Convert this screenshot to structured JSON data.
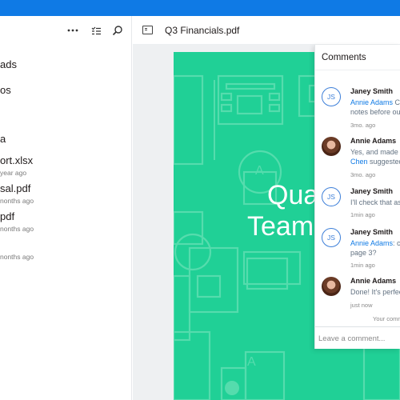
{
  "file_list": {
    "toolbar": {
      "more_icon": "more-horizontal-icon",
      "select_icon": "checklist-icon",
      "search_icon": "search-icon"
    },
    "items": [
      {
        "name": "ads",
        "sub": ""
      },
      {
        "name": "os",
        "sub": ""
      },
      {
        "name": "a",
        "sub": ""
      },
      {
        "name": "ort.xlsx",
        "sub": "year ago"
      },
      {
        "name": "sal.pdf",
        "sub": "nonths ago"
      },
      {
        "name": "pdf",
        "sub": "nonths ago"
      },
      {
        "name": "",
        "sub": "nonths ago"
      }
    ]
  },
  "viewer": {
    "file_title": "Q3 Financials.pdf",
    "doc_title_line1": "Qua",
    "doc_title_line2": "Team",
    "page_color": "#20d096"
  },
  "comments": {
    "title": "Comments",
    "items": [
      {
        "initials": "JS",
        "author": "Janey Smith",
        "mention": "Annie Adams",
        "text_l1": " Ca",
        "text_l2": "notes before our",
        "time": "3mo. ago",
        "avatar": "initials"
      },
      {
        "initials": "",
        "author": "Annie Adams",
        "mention": "",
        "text_l1": "Yes, and made su",
        "mention2": "Chen",
        "text_l2": " suggested",
        "time": "3mo. ago",
        "avatar": "photo"
      },
      {
        "initials": "JS",
        "author": "Janey Smith",
        "mention": "",
        "text_l1": "I'll check that as",
        "text_l2": "",
        "time": "1min ago",
        "avatar": "initials"
      },
      {
        "initials": "JS",
        "author": "Janey Smith",
        "mention": "Annie Adams",
        "text_l1": ": ca",
        "text_l2": "page 3?",
        "time": "1min ago",
        "avatar": "initials"
      },
      {
        "initials": "",
        "author": "Annie Adams",
        "mention": "",
        "text_l1": "Done! It's perfec",
        "text_l2": "",
        "time": "just now",
        "avatar": "photo"
      }
    ],
    "footnote": "Your comm",
    "input_placeholder": "Leave a comment..."
  },
  "colors": {
    "accent": "#0f7ae5",
    "mention": "#0f7ae5"
  }
}
